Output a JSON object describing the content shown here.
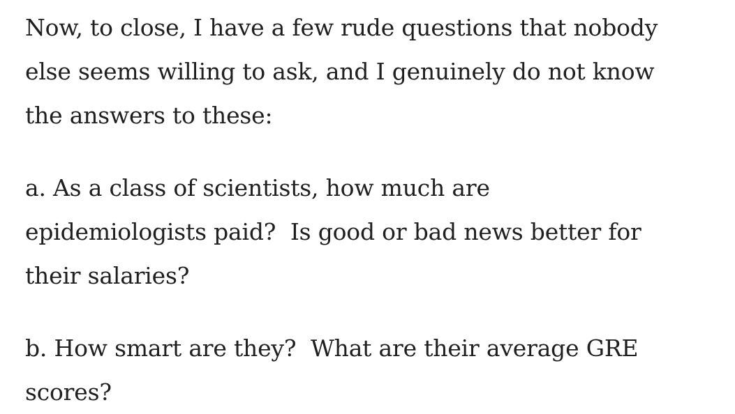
{
  "article": {
    "paragraphs": [
      "Now, to close, I have a few rude questions that nobody\nelse seems willing to ask, and I genuinely do not know\nthe answers to these:",
      "a. As a class of scientists, how much are\nepidemiologists paid?  Is good or bad news better for\ntheir salaries?",
      "b. How smart are they?  What are their average GRE\nscores?"
    ]
  }
}
